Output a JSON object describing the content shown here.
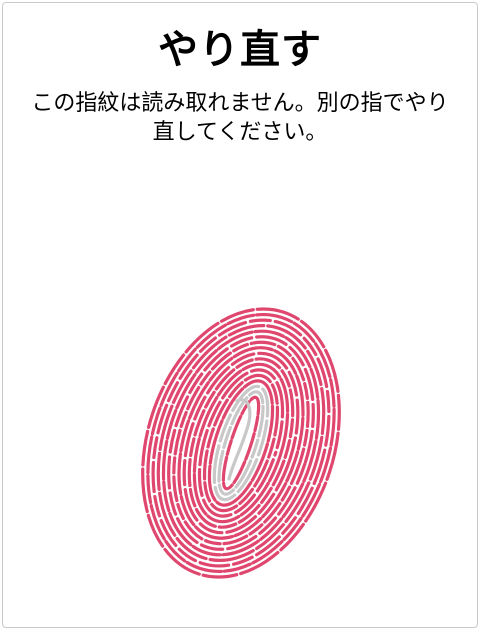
{
  "dialog": {
    "title": "やり直す",
    "message": "この指紋は読み取れません。別の指でやり直してください。"
  },
  "fingerprint": {
    "icon": "fingerprint-icon",
    "ridge_color": "#e0476e",
    "scanned_color": "#c8c8c8"
  }
}
